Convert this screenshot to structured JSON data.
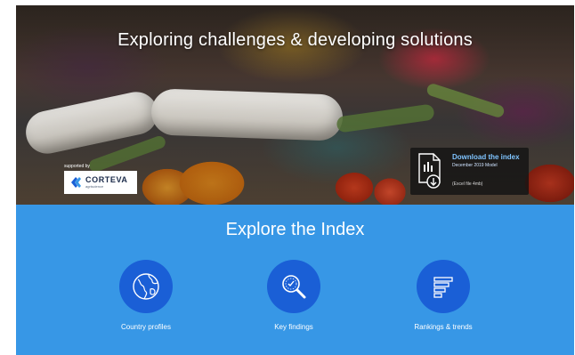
{
  "hero": {
    "title": "Exploring challenges & developing solutions",
    "supported_by": "supported by",
    "sponsor": {
      "name": "CORTEVA",
      "tagline": "agriscience"
    },
    "download": {
      "title": "Download the index",
      "subtitle": "December 2019 Model",
      "meta": "(Excel file 4mb)"
    }
  },
  "explore": {
    "title": "Explore the Index",
    "items": [
      {
        "label": "Country profiles",
        "icon": "globe-icon"
      },
      {
        "label": "Key findings",
        "icon": "magnifier-icon"
      },
      {
        "label": "Rankings & trends",
        "icon": "rankings-icon"
      }
    ]
  },
  "colors": {
    "explore_bg": "#3797e6",
    "circle_bg": "#1a5fd6",
    "download_title": "#7fc4ff"
  }
}
